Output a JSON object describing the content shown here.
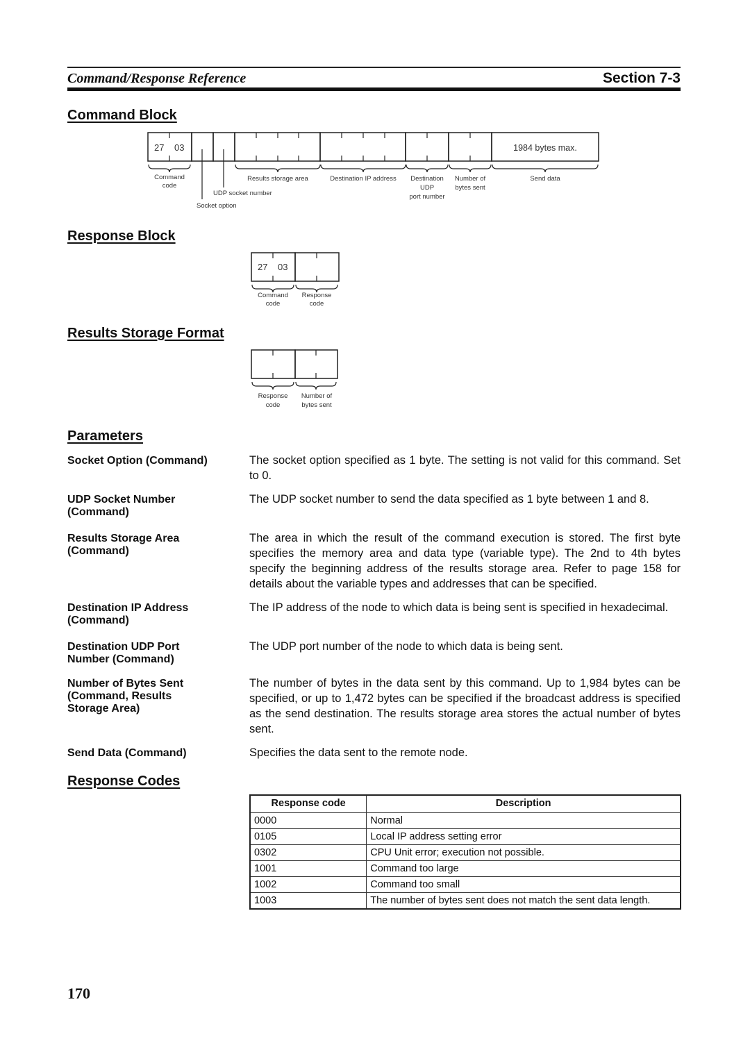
{
  "header": {
    "title": "Command/Response Reference",
    "section": "Section 7-3"
  },
  "command_block": {
    "heading": "Command Block",
    "command_code": [
      "27",
      "03"
    ],
    "send_data_box": "1984 bytes max.",
    "labels": {
      "command_code": [
        "Command",
        "code"
      ],
      "socket_option": "Socket option",
      "udp_socket_number": "UDP socket number",
      "results_storage_area": "Results storage area",
      "destination_ip": "Destination IP address",
      "destination_udp_port": [
        "Destination",
        "UDP",
        "port number"
      ],
      "bytes_sent": [
        "Number of",
        "bytes sent"
      ],
      "send_data": "Send data"
    }
  },
  "response_block": {
    "heading": "Response Block",
    "command_code": [
      "27",
      "03"
    ],
    "labels": {
      "command_code": [
        "Command",
        "code"
      ],
      "response_code": [
        "Response",
        "code"
      ]
    }
  },
  "results_storage_format": {
    "heading": "Results Storage Format",
    "labels": {
      "response_code": [
        "Response",
        "code"
      ],
      "bytes_sent": [
        "Number of",
        "bytes sent"
      ]
    }
  },
  "parameters": {
    "heading": "Parameters",
    "items": [
      {
        "label": "Socket Option (Command)",
        "text": "The socket option specified as 1 byte. The setting is not valid for this command. Set to 0."
      },
      {
        "label": "UDP Socket Number (Command)",
        "text": "The UDP socket number to send the data specified as 1 byte between 1 and 8."
      },
      {
        "label": "Results Storage Area (Command)",
        "text": "The area in which the result of the command execution is stored. The first byte specifies the memory area and data type (variable type). The 2nd to 4th bytes specify the beginning address of the results storage area. Refer to page 158 for details about the variable types and addresses that can be specified."
      },
      {
        "label": "Destination IP Address (Command)",
        "text": "The IP address of the node to which data is being sent is specified in hexadecimal."
      },
      {
        "label": "Destination UDP Port Number (Command)",
        "text": "The UDP port number of the node to which data is being sent."
      },
      {
        "label": "Number of Bytes Sent (Command, Results Storage Area)",
        "text": "The number of bytes in the data sent by this command. Up to 1,984 bytes can be specified, or up to 1,472 bytes can be specified if the broadcast address is specified as the send destination. The results storage area stores the actual number of bytes sent."
      },
      {
        "label": "Send Data (Command)",
        "text": "Specifies the data sent to the remote node."
      }
    ]
  },
  "response_codes": {
    "heading": "Response Codes",
    "columns": [
      "Response code",
      "Description"
    ],
    "rows": [
      {
        "code": "0000",
        "description": "Normal"
      },
      {
        "code": "0105",
        "description": "Local IP address setting error"
      },
      {
        "code": "0302",
        "description": "CPU Unit error; execution not possible."
      },
      {
        "code": "1001",
        "description": "Command too large"
      },
      {
        "code": "1002",
        "description": "Command too small"
      },
      {
        "code": "1003",
        "description": "The number of bytes sent does not match the sent data length."
      }
    ]
  },
  "footer": {
    "page_number": "170"
  }
}
